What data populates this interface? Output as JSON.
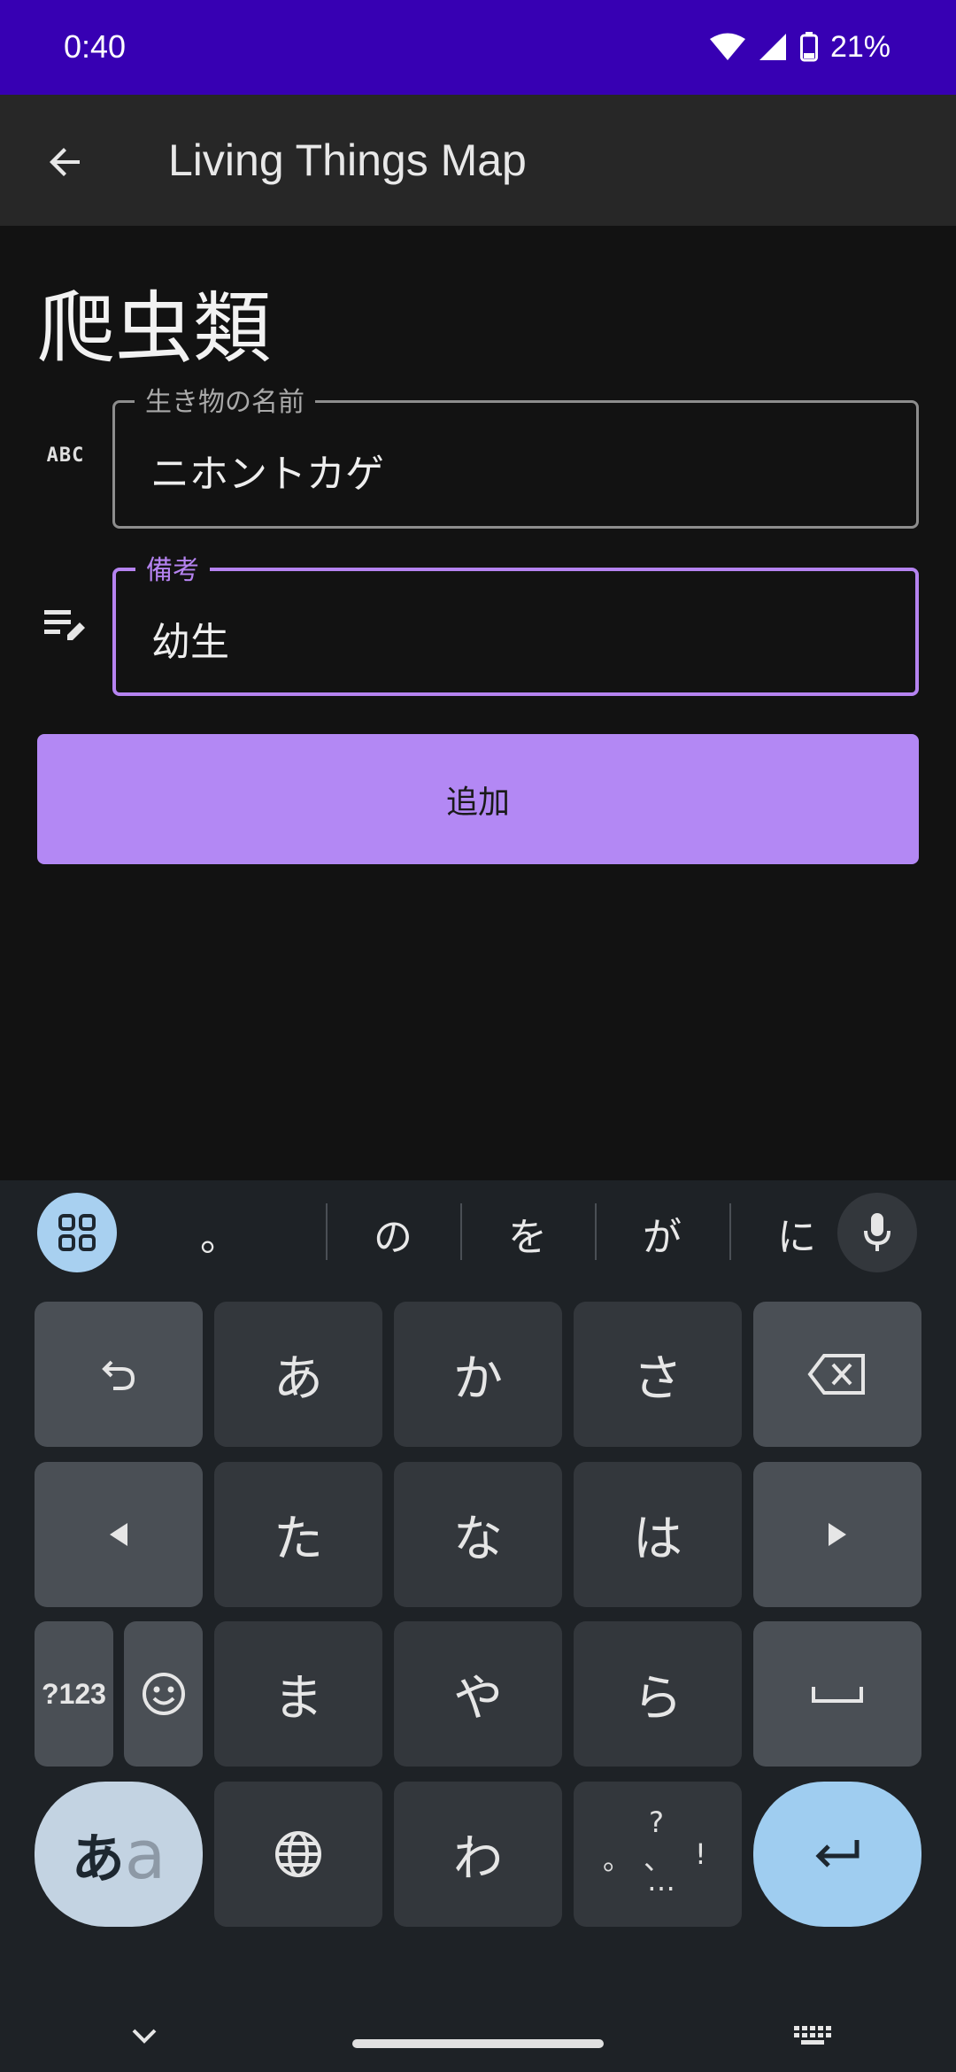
{
  "status": {
    "time": "0:40",
    "battery": "21%"
  },
  "appbar": {
    "title": "Living Things Map"
  },
  "page": {
    "category_title": "爬虫類"
  },
  "form": {
    "name_label": "生き物の名前",
    "name_value": "ニホントカゲ",
    "name_icon_text": "ABC",
    "notes_label": "備考",
    "notes_value": "幼生",
    "submit_label": "追加"
  },
  "keyboard": {
    "suggestions": [
      "。",
      "の",
      "を",
      "が",
      "に"
    ],
    "row1": [
      "あ",
      "か",
      "さ"
    ],
    "row2": [
      "た",
      "な",
      "は"
    ],
    "row3": [
      "ま",
      "や",
      "ら"
    ],
    "row4_wa": "わ",
    "num_toggle": "?123",
    "kana_toggle_kana": "あ",
    "kana_toggle_latin": "a",
    "punct": {
      "top": "?",
      "left": "。",
      "mid": "、",
      "right": "!",
      "bottom": "…"
    }
  }
}
